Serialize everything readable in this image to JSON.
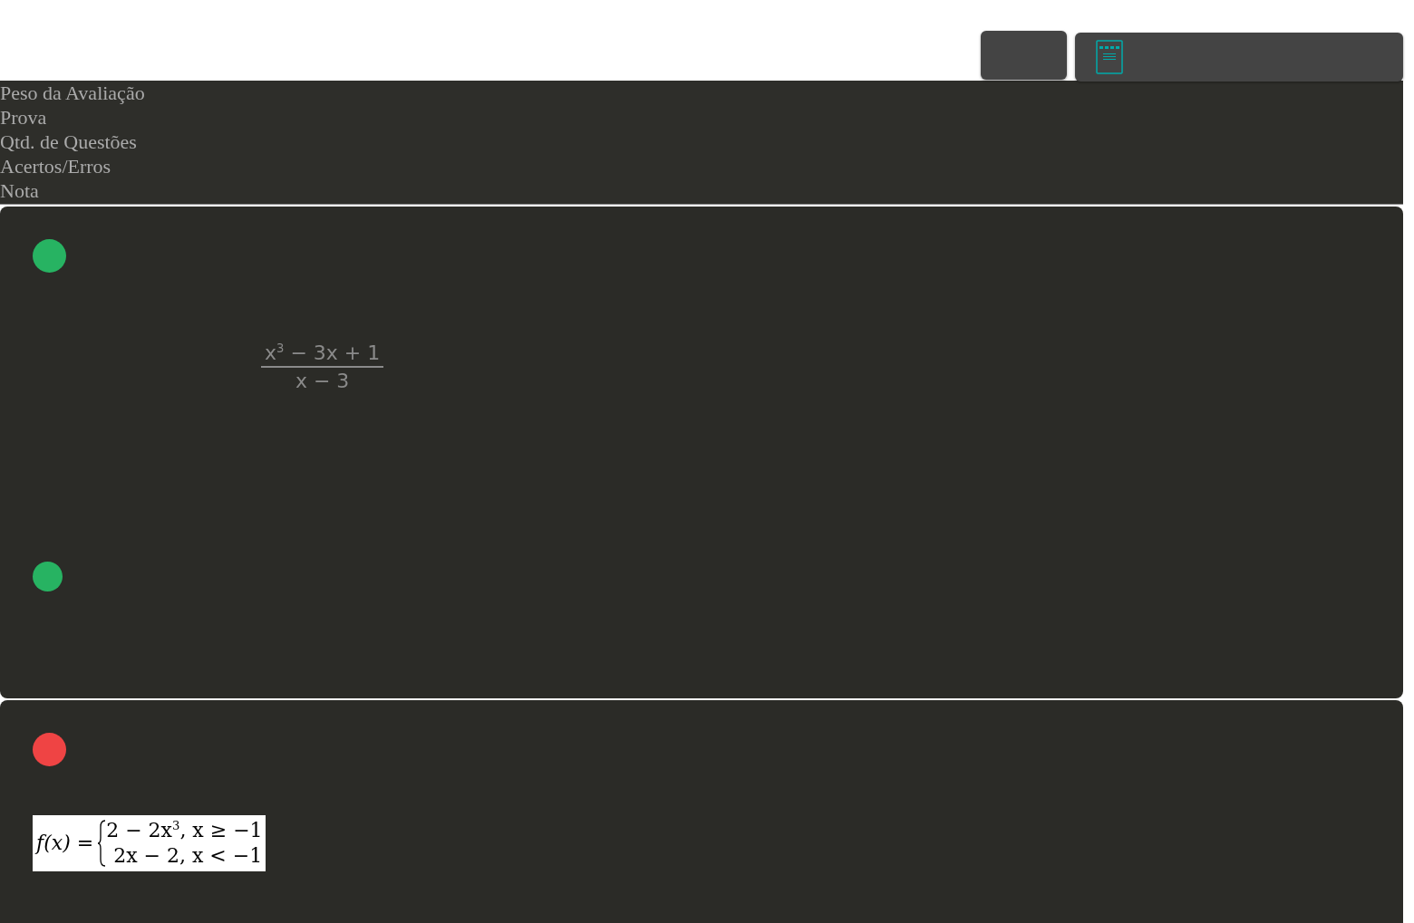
{
  "summary_labels": [
    "Peso da Avaliação",
    "Prova",
    "Qtd. de Questões",
    "Acertos/Erros",
    "Nota"
  ],
  "cards": [
    {
      "blocks": [
        {
          "kind": "dot",
          "color": "#27b362"
        },
        {
          "kind": "fraction",
          "numerator": "x$^{3}$ − 3x + 1",
          "denominator": "x − 3"
        },
        {
          "kind": "dot",
          "color": "#27b362"
        }
      ]
    },
    {
      "blocks": [
        {
          "kind": "dot",
          "color": "#ef4444"
        },
        {
          "kind": "piecewise",
          "head": "f(x) =",
          "cases": [
            "2 − 2x$^{3}$, x ≥ −1",
            "2x − 2, x < −1"
          ]
        }
      ]
    }
  ]
}
